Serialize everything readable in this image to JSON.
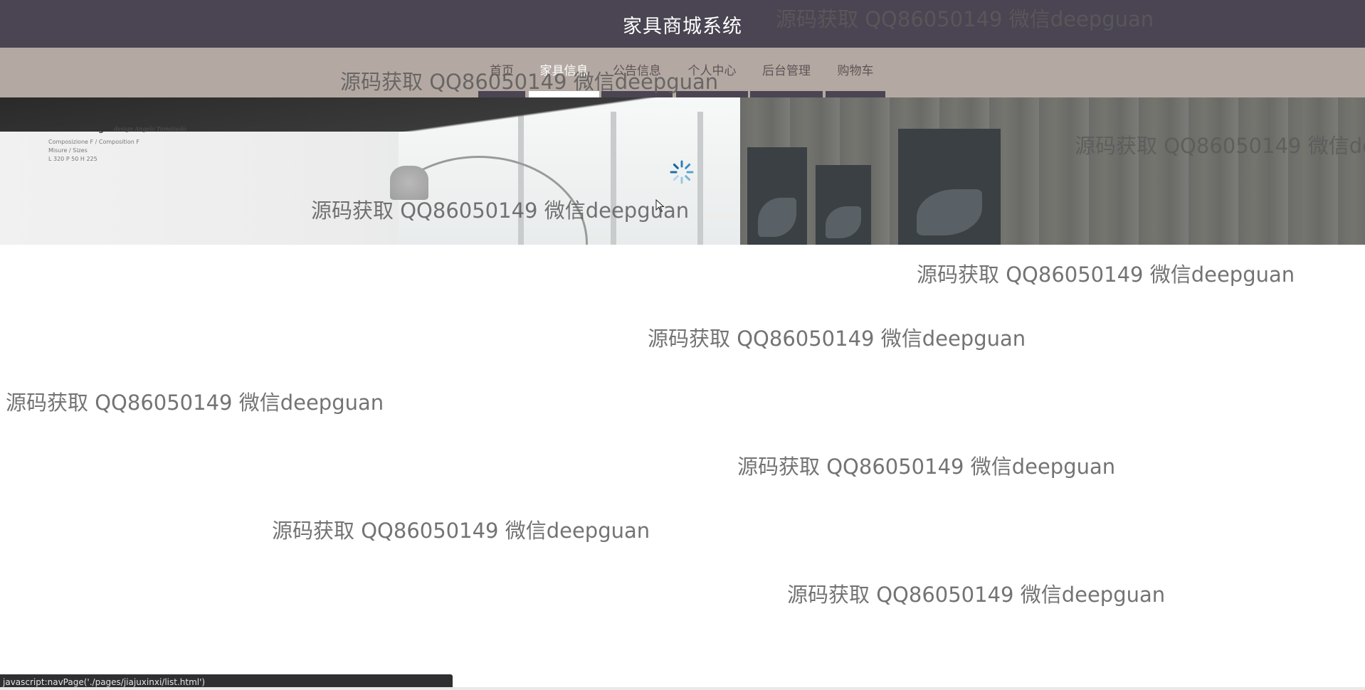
{
  "header": {
    "site_title": "家具商城系统"
  },
  "nav": {
    "items": [
      {
        "label": "首页",
        "active": false
      },
      {
        "label": "家具信息",
        "active": true
      },
      {
        "label": "公告信息",
        "active": false
      },
      {
        "label": "个人中心",
        "active": false
      },
      {
        "label": "后台管理",
        "active": false
      },
      {
        "label": "购物车",
        "active": false
      }
    ]
  },
  "banner": {
    "brand": "leaves living",
    "brand_sub": "design Angelo Tomaiuolo",
    "detail_lines": [
      "Composizione F / Composition F",
      "Misure / Sizes",
      "L 320 P 50 H 225"
    ]
  },
  "watermark": {
    "text": "源码获取 QQ86050149 微信deepguan"
  },
  "statusbar": {
    "url": "javascript:navPage('./pages/jiajuxinxi/list.html')"
  },
  "colors": {
    "header_bg": "#4b4452",
    "navbar_bg": "#b4a9a2",
    "nav_text": "#5f5357",
    "nav_active_text": "#ffffff"
  },
  "icons": {
    "loading": "spinner-icon",
    "cursor": "mouse-pointer-icon"
  }
}
